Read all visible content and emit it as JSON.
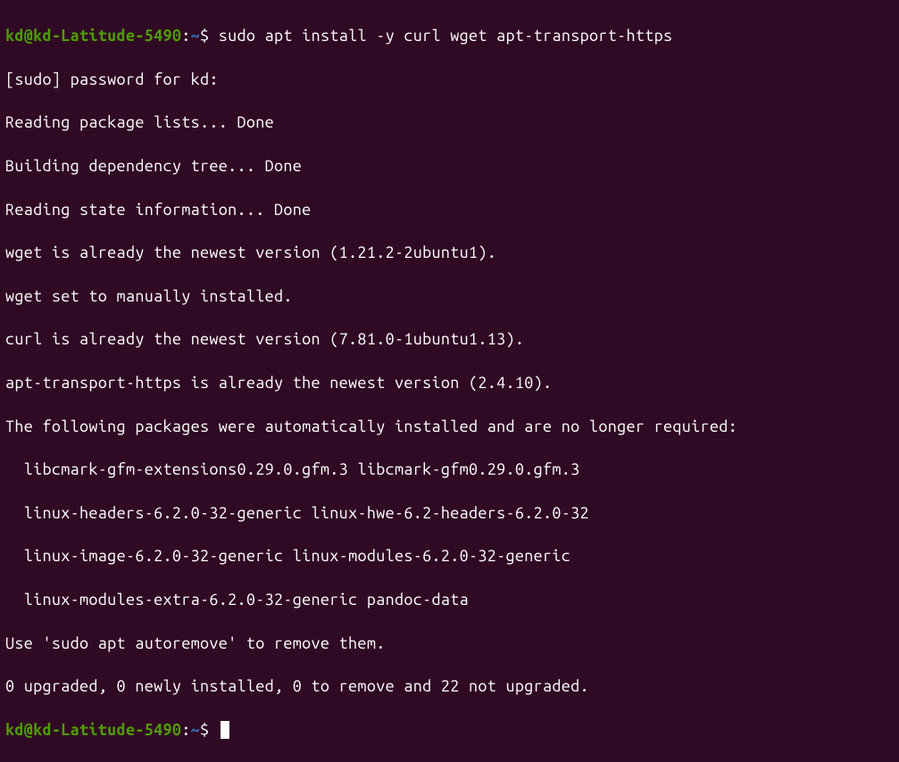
{
  "prompt1": {
    "user": "kd@kd-Latitude-5490",
    "colon": ":",
    "path": "~",
    "dollar": "$ ",
    "command": "sudo apt install -y curl wget apt-transport-https"
  },
  "output": {
    "line1": "[sudo] password for kd:",
    "line2": "Reading package lists... Done",
    "line3": "Building dependency tree... Done",
    "line4": "Reading state information... Done",
    "line5": "wget is already the newest version (1.21.2-2ubuntu1).",
    "line6": "wget set to manually installed.",
    "line7": "curl is already the newest version (7.81.0-1ubuntu1.13).",
    "line8": "apt-transport-https is already the newest version (2.4.10).",
    "line9": "The following packages were automatically installed and are no longer required:",
    "line10": "  libcmark-gfm-extensions0.29.0.gfm.3 libcmark-gfm0.29.0.gfm.3",
    "line11": "  linux-headers-6.2.0-32-generic linux-hwe-6.2-headers-6.2.0-32",
    "line12": "  linux-image-6.2.0-32-generic linux-modules-6.2.0-32-generic",
    "line13": "  linux-modules-extra-6.2.0-32-generic pandoc-data",
    "line14": "Use 'sudo apt autoremove' to remove them.",
    "line15": "0 upgraded, 0 newly installed, 0 to remove and 22 not upgraded."
  },
  "prompt2": {
    "user": "kd@kd-Latitude-5490",
    "colon": ":",
    "path": "~",
    "dollar": "$ "
  }
}
